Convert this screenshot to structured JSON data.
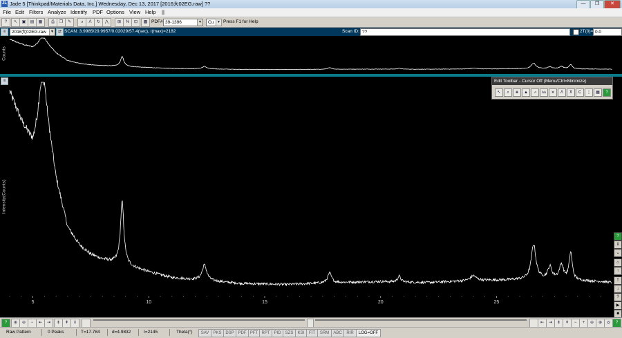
{
  "window": {
    "title": "Jade 5 [Thinkpad/Materials Data, Inc.] Wednesday, Dec 13, 2017 [2016大02EG.raw] ??",
    "app_icon": "JL",
    "min_label": "—",
    "max_label": "❐",
    "close_label": "✕"
  },
  "menu": [
    "File",
    "Edit",
    "Filters",
    "Analyze",
    "Identify",
    "PDF",
    "Options",
    "View",
    "Help",
    "||"
  ],
  "toolbar": {
    "pdf_label": "PDF#",
    "pdf_value": "39-1396",
    "anode_value": "Cu",
    "help_text": "Press F1 for Help"
  },
  "scan_bar": {
    "file_value": "2016大02EG.raw",
    "scan_text": "SCAN: 3.9985/29.9957/0.02029/57.4(sec), I(max)=2182",
    "scan_id_label": "Scan ID:",
    "scan_id_value": "??",
    "twotheta_label": "2T(0)=",
    "twotheta_value": "0.0"
  },
  "plot": {
    "top_ylabel": "Counts",
    "main_ylabel": "Intensity(Counts)",
    "x_ticks": [
      "5",
      "10",
      "15",
      "20",
      "25"
    ]
  },
  "edit_toolbar": {
    "title": "Edit Toolbar - Cursor Off (Menu/Ctrl=Minimize)"
  },
  "status": {
    "mode": "Raw Pattern",
    "peaks": "0 Peaks",
    "t_value": "T=17.784",
    "d_value": "d=4.9832",
    "i_value": "I=2145",
    "theta_label": "Theta(°)",
    "tabs": [
      "SAV",
      "PKS",
      "DSP",
      "PDF",
      "PFT",
      "RPT",
      "PID",
      "SZS",
      "KSI",
      "FIT",
      "SRM",
      "ABC",
      "RIR"
    ],
    "log_label": "LOG=OFF"
  },
  "colors": {
    "plot_bg": "#000000",
    "trace": "#ffffff",
    "separator": "#0a7a8a",
    "toolbar_dark": "#00375a"
  },
  "chart_data": {
    "type": "line",
    "xlabel": "",
    "ylabel": "Intensity(Counts)",
    "xlim": [
      3.9985,
      29.9957
    ],
    "ylim": [
      0,
      2200
    ],
    "xticks": [
      5,
      10,
      15,
      20,
      25
    ],
    "grid": false,
    "background": {
      "x": [
        4.0,
        4.5,
        5.0,
        5.2,
        5.5,
        6.0,
        6.5,
        7.0,
        7.5,
        8.0,
        9.0,
        10.0,
        11.0,
        12.0,
        14.0,
        16.0,
        18.0,
        20.0,
        22.0,
        24.0,
        26.0,
        27.5,
        28.5,
        29.5,
        30.0
      ],
      "y": [
        2100,
        1800,
        1560,
        1680,
        2000,
        1200,
        700,
        520,
        420,
        370,
        310,
        240,
        180,
        160,
        120,
        110,
        130,
        140,
        130,
        150,
        160,
        170,
        150,
        140,
        130
      ]
    },
    "peaks": [
      {
        "x": 5.35,
        "height": 350,
        "width": 0.18
      },
      {
        "x": 8.85,
        "height": 640,
        "width": 0.09
      },
      {
        "x": 12.4,
        "height": 160,
        "width": 0.12
      },
      {
        "x": 17.8,
        "height": 100,
        "width": 0.1
      },
      {
        "x": 20.8,
        "height": 60,
        "width": 0.08
      },
      {
        "x": 24.0,
        "height": 50,
        "width": 0.15
      },
      {
        "x": 26.6,
        "height": 360,
        "width": 0.12
      },
      {
        "x": 27.3,
        "height": 120,
        "width": 0.1
      },
      {
        "x": 27.8,
        "height": 150,
        "width": 0.1
      },
      {
        "x": 28.2,
        "height": 280,
        "width": 0.08
      }
    ],
    "noise": 22
  }
}
